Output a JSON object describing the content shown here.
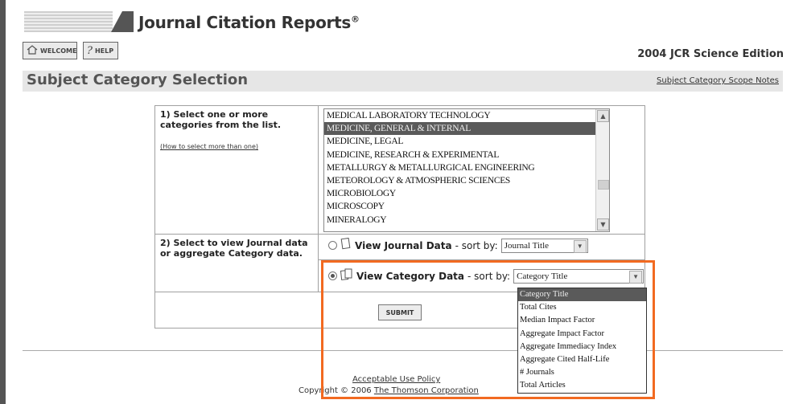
{
  "header": {
    "app_title": "Journal Citation Reports",
    "app_title_mark": "®",
    "edition": "2004 JCR Science Edition",
    "nav": [
      {
        "label": "WELCOME",
        "icon": "home-icon"
      },
      {
        "label": "HELP",
        "icon": "question-icon"
      }
    ]
  },
  "page": {
    "title": "Subject Category Selection",
    "scope_link": "Subject Category Scope Notes"
  },
  "step1": {
    "label": "1) Select one or more categories from the list.",
    "help_link": "(How to select more than one)",
    "categories": [
      {
        "label": "MEDICAL LABORATORY TECHNOLOGY",
        "selected": false
      },
      {
        "label": "MEDICINE, GENERAL & INTERNAL",
        "selected": true
      },
      {
        "label": "MEDICINE, LEGAL",
        "selected": false
      },
      {
        "label": "MEDICINE, RESEARCH & EXPERIMENTAL",
        "selected": false
      },
      {
        "label": "METALLURGY & METALLURGICAL ENGINEERING",
        "selected": false
      },
      {
        "label": "METEOROLOGY & ATMOSPHERIC SCIENCES",
        "selected": false
      },
      {
        "label": "MICROBIOLOGY",
        "selected": false
      },
      {
        "label": "MICROSCOPY",
        "selected": false
      },
      {
        "label": "MINERALOGY",
        "selected": false
      }
    ]
  },
  "step2": {
    "label": "2) Select to view Journal data or aggregate Category data.",
    "journal_option": {
      "label": "View Journal Data",
      "sort_prefix": "- sort by:",
      "sort_value": "Journal Title",
      "checked": false
    },
    "category_option": {
      "label": "View Category Data",
      "sort_prefix": "- sort by:",
      "sort_value": "Category Title",
      "checked": true
    },
    "sort_options": [
      "Category Title",
      "Total Cites",
      "Median Impact Factor",
      "Aggregate Impact Factor",
      "Aggregate Immediacy Index",
      "Aggregate Cited Half-Life",
      "# Journals",
      "Total Articles"
    ]
  },
  "submit_label": "SUBMIT",
  "footer": {
    "policy_link": "Acceptable Use Policy",
    "copyright_prefix": "Copyright © 2006",
    "company_link": "The Thomson Corporation"
  },
  "colors": {
    "highlight": "#f26a21",
    "selected_bg": "#5a5a5a"
  }
}
